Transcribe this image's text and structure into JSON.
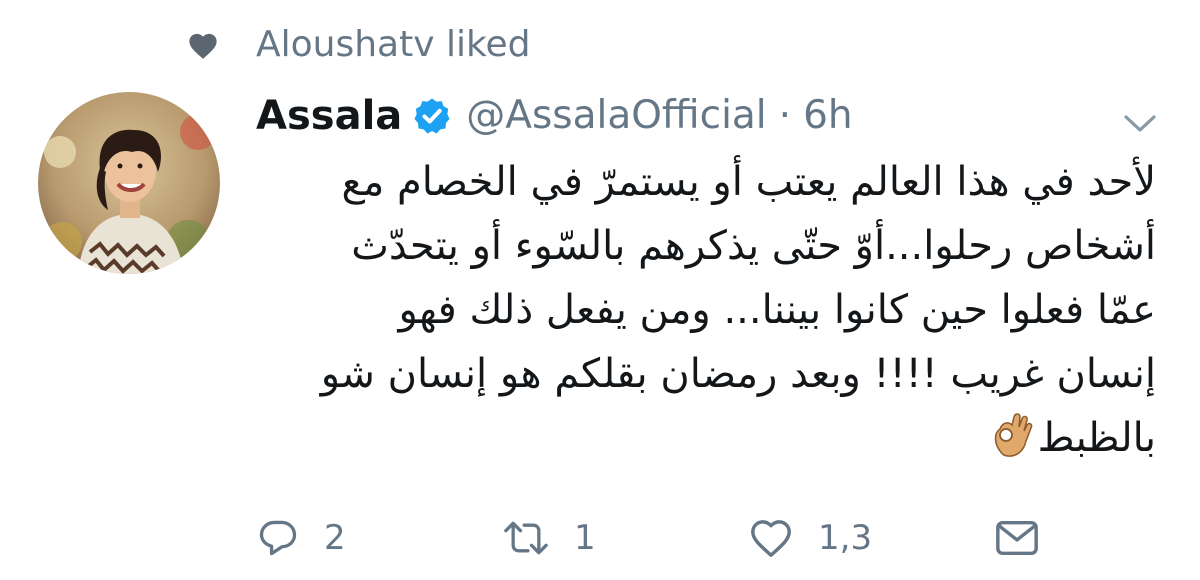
{
  "context": {
    "icon": "heart-icon",
    "text": "Aloushatv liked"
  },
  "author": {
    "display_name": "Assala",
    "verified": true,
    "handle": "@AssalaOfficial",
    "separator": "·",
    "time": "6h"
  },
  "tweet": {
    "lines": [
      "لأحد في هذا العالم يعتب أو يستمرّ في الخصام مع",
      "أشخاص رحلوا...أوّ حتّى يذكرهم بالسّوء أو يتحدّث",
      "عمّا فعلوا حين كانوا بيننا... ومن يفعل ذلك فهو",
      "إنسان غريب !!!! وبعد رمضان بقلكم هو إنسان شو",
      "بالظبط"
    ],
    "emoji": "ok-hand-emoji"
  },
  "actions": {
    "reply_count": "2",
    "retweet_count": "1",
    "like_count": "1,3",
    "dm_icon": "envelope-icon"
  },
  "colors": {
    "text": "#14171a",
    "muted": "#657786",
    "icon_gray": "#8899a6",
    "verified_blue": "#1da1f2",
    "context_heart": "#5c6670"
  }
}
